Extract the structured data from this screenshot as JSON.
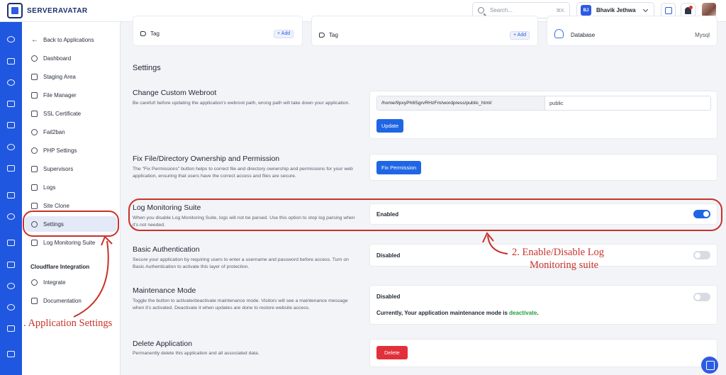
{
  "app": {
    "brand": "SERVERAVATAR"
  },
  "topbar": {
    "search_placeholder": "Search...",
    "search_shortcut": "⌘K",
    "user_initials": "BJ",
    "user_name": "Bhavik Jethwa"
  },
  "sidebar": {
    "back": "Back to Applications",
    "items": [
      {
        "label": "Dashboard",
        "icon": "dashboard-icon"
      },
      {
        "label": "Staging Area",
        "icon": "staging-icon"
      },
      {
        "label": "File Manager",
        "icon": "file-icon"
      },
      {
        "label": "SSL Certificate",
        "icon": "lock-icon"
      },
      {
        "label": "Fail2ban",
        "icon": "ban-icon"
      },
      {
        "label": "PHP Settings",
        "icon": "php-icon"
      },
      {
        "label": "Supervisors",
        "icon": "tools-icon"
      },
      {
        "label": "Logs",
        "icon": "logs-icon"
      },
      {
        "label": "Site Clone",
        "icon": "clone-icon"
      },
      {
        "label": "Settings",
        "icon": "gear-icon",
        "active": true
      },
      {
        "label": "Log Monitoring Suite",
        "icon": "monitor-icon"
      }
    ],
    "cloudflare_heading": "Cloudflare Integration",
    "cloudflare_items": [
      {
        "label": "Integrate",
        "icon": "cloud-icon"
      },
      {
        "label": "Documentation",
        "icon": "doc-icon"
      }
    ]
  },
  "top_cards": {
    "tag_label_1": "Tag",
    "tag_label_2": "Tag",
    "add_label": "+ Add",
    "database_label": "Database",
    "database_value": "Mysql"
  },
  "settings": {
    "title": "Settings",
    "webroot": {
      "title": "Change Custom Webroot",
      "desc": "Be careful! before updating the application's webroot path, wrong path will take down your application.",
      "path_prefix": "/home/9pxyPh6SgrvRHzFm/wordpress/public_html/",
      "path_value": "public",
      "button": "Update"
    },
    "permission": {
      "title": "Fix File/Directory Ownership and Permission",
      "desc": "The \"Fix Permissions\" button helps to correct file and directory ownership and permissions for your web application, ensuring that users have the correct access and files are secure.",
      "button": "Fix Permission"
    },
    "log_monitoring": {
      "title": "Log Monitoring Suite",
      "desc": "When you disable Log Monitoring Suite, logs will not be parsed. Use this option to stop log parsing when it's not needed.",
      "status": "Enabled",
      "enabled": true
    },
    "basic_auth": {
      "title": "Basic Authentication",
      "desc": "Secure your application by requiring users to enter a username and password before access. Turn on Basic Authentication to activate this layer of protection.",
      "status": "Disabled",
      "enabled": false
    },
    "maintenance": {
      "title": "Maintenance Mode",
      "desc": "Toggle the button to activate/deactivate maintenance mode. Visitors will see a maintenance message when it's activated. Deactivate it when updates are done to restore website access.",
      "status": "Disabled",
      "enabled": false,
      "note_prefix": "Currently, Your application maintenance mode is",
      "note_value": "deactivate",
      "note_suffix": "."
    },
    "delete": {
      "title": "Delete Application",
      "desc": "Permanently delete this application and all associated data.",
      "button": "Delete"
    }
  },
  "annotations": {
    "app_settings": ". Application Settings",
    "enable_disable_line1": "2. Enable/Disable Log",
    "enable_disable_line2": "Monitoring suite",
    "color": "#c8322a"
  },
  "colors": {
    "accent": "#1f66e5",
    "rail": "#2057e0",
    "danger": "#e2303a",
    "success": "#1e9e3a"
  }
}
